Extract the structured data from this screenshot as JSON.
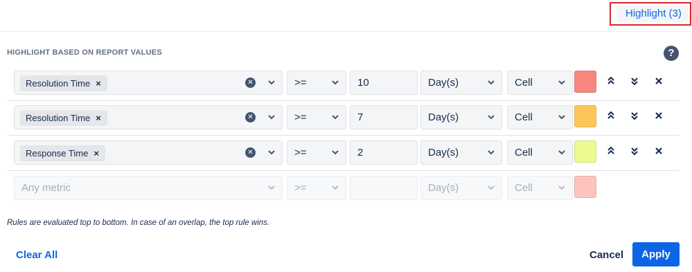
{
  "header": {
    "highlight_tab": "Highlight (3)"
  },
  "section": {
    "title": "HIGHLIGHT BASED ON REPORT VALUES",
    "help_icon": "question-circle-icon"
  },
  "rules": [
    {
      "metric": "Resolution Time",
      "operator": ">=",
      "value": "10",
      "unit": "Day(s)",
      "scope": "Cell",
      "color": "#f8877f"
    },
    {
      "metric": "Resolution Time",
      "operator": ">=",
      "value": "7",
      "unit": "Day(s)",
      "scope": "Cell",
      "color": "#fec65a"
    },
    {
      "metric": "Response Time",
      "operator": ">=",
      "value": "2",
      "unit": "Day(s)",
      "scope": "Cell",
      "color": "#eefa8e"
    }
  ],
  "new_rule": {
    "metric_placeholder": "Any metric",
    "operator": ">=",
    "unit": "Day(s)",
    "scope": "Cell",
    "color": "#fdc4bd"
  },
  "chip_remove": "×",
  "note": "Rules are evaluated top to bottom. In case of an overlap, the top rule wins.",
  "footer": {
    "clear_all": "Clear All",
    "cancel": "Cancel",
    "apply": "Apply"
  }
}
